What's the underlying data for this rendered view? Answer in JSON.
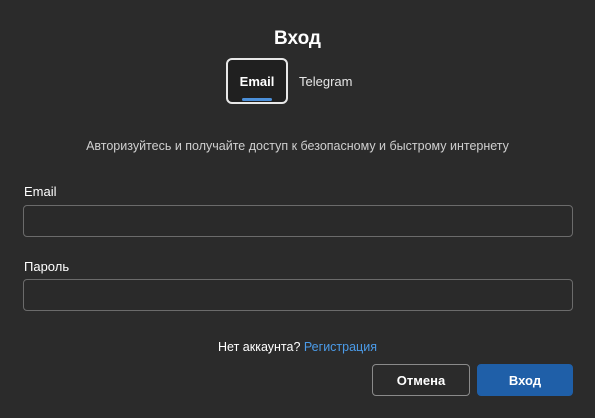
{
  "dialog": {
    "title": "Вход",
    "subtitle": "Авторизуйтесь и получайте доступ к безопасному и быстрому интернету"
  },
  "tabs": [
    {
      "label": "Email",
      "active": true
    },
    {
      "label": "Telegram",
      "active": false
    }
  ],
  "form": {
    "email_label": "Email",
    "email_value": "",
    "password_label": "Пароль",
    "password_value": ""
  },
  "signup": {
    "question": "Нет аккаунта?",
    "link": "Регистрация"
  },
  "buttons": {
    "cancel": "Отмена",
    "submit": "Вход"
  },
  "colors": {
    "background": "#2b2b2b",
    "accent": "#1f5fa8",
    "link": "#4b9be8",
    "tab_indicator": "#4b8fd8"
  }
}
